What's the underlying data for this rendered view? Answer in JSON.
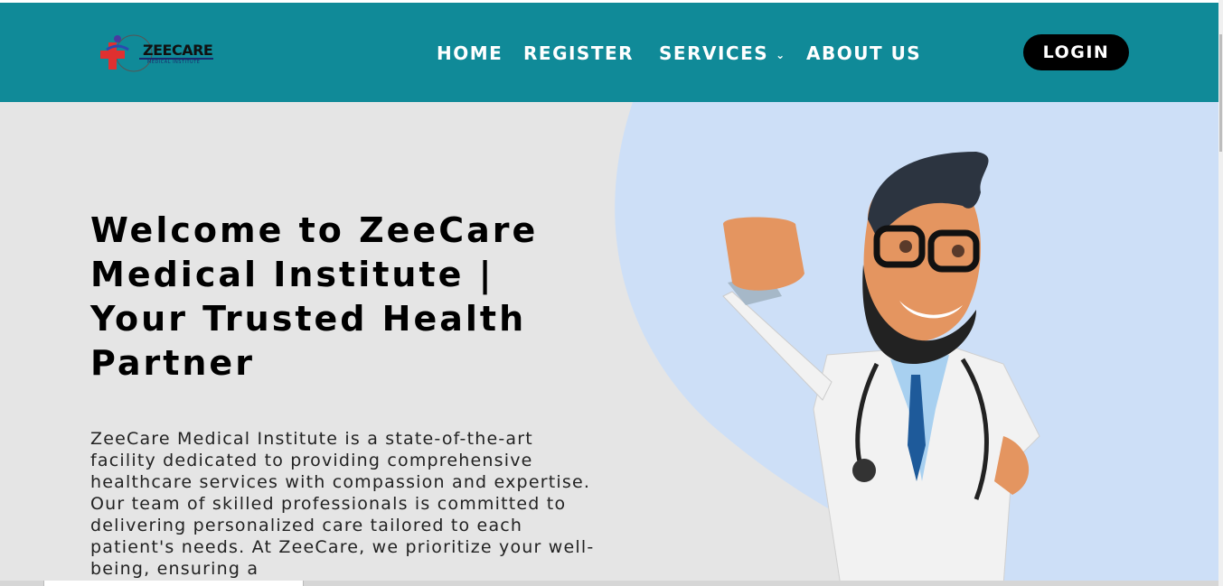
{
  "brand": {
    "name": "ZEECARE",
    "subtitle": "MEDICAL INSTITUTE"
  },
  "nav": {
    "home": "HOME",
    "register": "REGISTER",
    "services": "SERVICES",
    "about": "ABOUT US",
    "login": "LOGIN"
  },
  "hero": {
    "title": "Welcome to ZeeCare Medical Institute | Your Trusted Health Partner",
    "description": "ZeeCare Medical Institute is a state-of-the-art facility dedicated to providing comprehensive healthcare services with compassion and expertise. Our team of skilled professionals is committed to delivering personalized care tailored to each patient's needs. At ZeeCare, we prioritize your well-being, ensuring a"
  },
  "icons": {
    "services_dropdown": "chevron-down-icon",
    "logo": "medical-cross-logo-icon"
  },
  "colors": {
    "navbar": "#108a98",
    "login_button": "#000000",
    "hero_background": "#e5e5e5",
    "hero_accent": "#cddff7"
  }
}
